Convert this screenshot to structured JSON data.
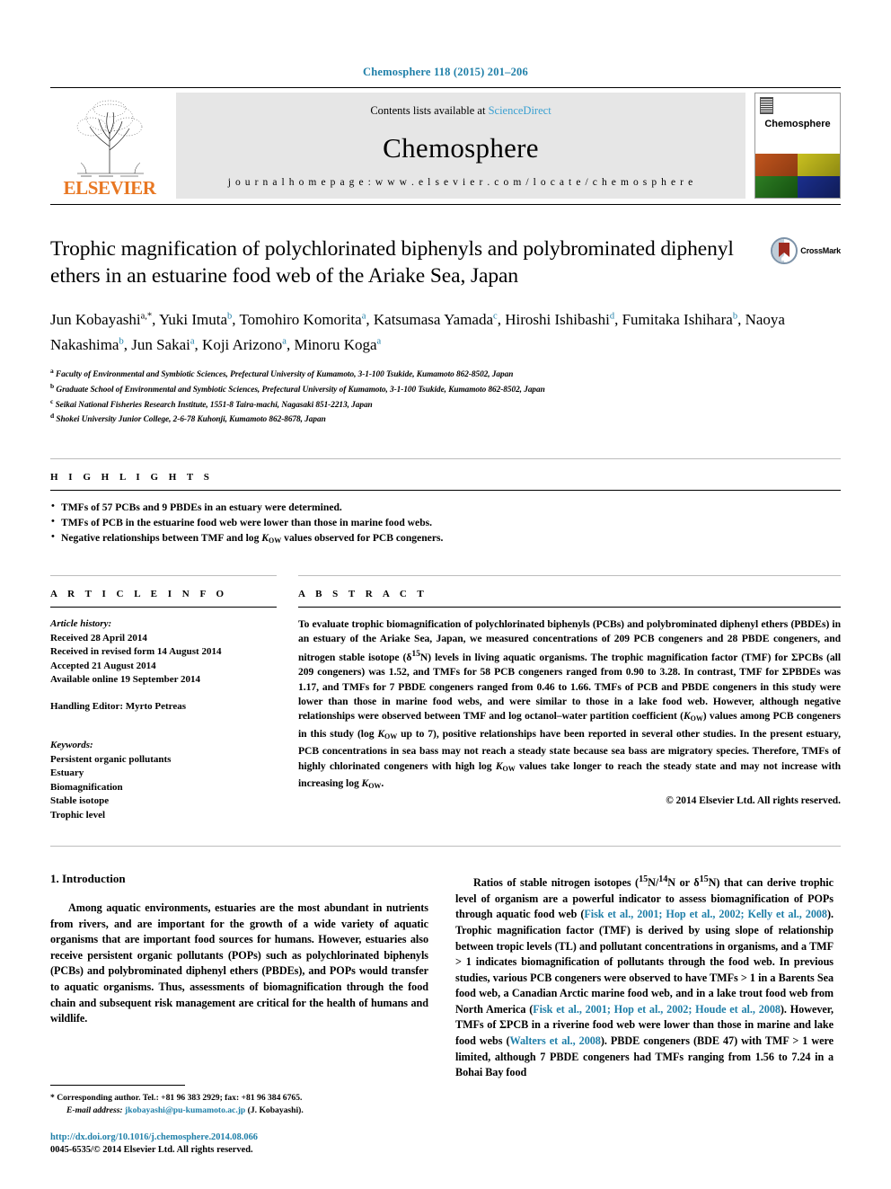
{
  "running_head": "Chemosphere 118 (2015) 201–206",
  "banner": {
    "publisher": "ELSEVIER",
    "contents_prefix": "Contents lists available at ",
    "contents_link": "ScienceDirect",
    "journal_name": "Chemosphere",
    "homepage": "j o u r n a l   h o m e p a g e :   w w w . e l s e v i e r . c o m / l o c a t e / c h e m o s p h e r e",
    "cover_title": "Chemosphere"
  },
  "article": {
    "title": "Trophic magnification of polychlorinated biphenyls and polybrominated diphenyl ethers in an estuarine food web of the Ariake Sea, Japan",
    "crossmark_label": "CrossMark",
    "authors_line_1": "Jun Kobayashi",
    "authors": [
      {
        "name": "Jun Kobayashi",
        "marks": "a,*"
      },
      {
        "name": "Yuki Imuta",
        "marks": "b"
      },
      {
        "name": "Tomohiro Komorita",
        "marks": "a"
      },
      {
        "name": "Katsumasa Yamada",
        "marks": "c"
      },
      {
        "name": "Hiroshi Ishibashi",
        "marks": "d"
      },
      {
        "name": "Fumitaka Ishihara",
        "marks": "b"
      },
      {
        "name": "Naoya Nakashima",
        "marks": "b"
      },
      {
        "name": "Jun Sakai",
        "marks": "a"
      },
      {
        "name": "Koji Arizono",
        "marks": "a"
      },
      {
        "name": "Minoru Koga",
        "marks": "a"
      }
    ],
    "affiliations": [
      {
        "mark": "a",
        "text": "Faculty of Environmental and Symbiotic Sciences, Prefectural University of Kumamoto, 3-1-100 Tsukide, Kumamoto 862-8502, Japan"
      },
      {
        "mark": "b",
        "text": "Graduate School of Environmental and Symbiotic Sciences, Prefectural University of Kumamoto, 3-1-100 Tsukide, Kumamoto 862-8502, Japan"
      },
      {
        "mark": "c",
        "text": "Seikai National Fisheries Research Institute, 1551-8 Taira-machi, Nagasaki 851-2213, Japan"
      },
      {
        "mark": "d",
        "text": "Shokei University Junior College, 2-6-78 Kuhonji, Kumamoto 862-8678, Japan"
      }
    ]
  },
  "highlights": {
    "heading": "H I G H L I G H T S",
    "items": [
      "TMFs of 57 PCBs and 9 PBDEs in an estuary were determined.",
      "TMFs of PCB in the estuarine food web were lower than those in marine food webs.",
      "Negative relationships between TMF and log KOW values observed for PCB congeners."
    ]
  },
  "article_info": {
    "heading": "A R T I C L E   I N F O",
    "history_label": "Article history:",
    "history": [
      "Received 28 April 2014",
      "Received in revised form 14 August 2014",
      "Accepted 21 August 2014",
      "Available online 19 September 2014"
    ],
    "handling_editor": "Handling Editor: Myrto Petreas",
    "keywords_label": "Keywords:",
    "keywords": [
      "Persistent organic pollutants",
      "Estuary",
      "Biomagnification",
      "Stable isotope",
      "Trophic level"
    ]
  },
  "abstract": {
    "heading": "A B S T R A C T",
    "text_part_1": "To evaluate trophic biomagnification of polychlorinated biphenyls (PCBs) and polybrominated diphenyl ethers (PBDEs) in an estuary of the Ariake Sea, Japan, we measured concentrations of 209 PCB congeners and 28 PBDE congeners, and nitrogen stable isotope (δ",
    "isotope_sup": "15",
    "text_part_2": "N) levels in living aquatic organisms. The trophic magnification factor (TMF) for ΣPCBs (all 209 congeners) was 1.52, and TMFs for 58 PCB congeners ranged from 0.90 to 3.28. In contrast, TMF for ΣPBDEs was 1.17, and TMFs for 7 PBDE congeners ranged from 0.46 to 1.66. TMFs of PCB and PBDE congeners in this study were lower than those in marine food webs, and were similar to those in a lake food web. However, although negative relationships were observed between TMF and log octanol–water partition coefficient (",
    "kow_1": "KOW",
    "text_part_3": ") values among PCB congeners in this study (log ",
    "kow_2": "KOW",
    "text_part_4": " up to 7), positive relationships have been reported in several other studies. In the present estuary, PCB concentrations in sea bass may not reach a steady state because sea bass are migratory species. Therefore, TMFs of highly chlorinated congeners with high log ",
    "kow_3": "KOW",
    "text_part_5": " values take longer to reach the steady state and may not increase with increasing log ",
    "kow_4": "KOW",
    "text_part_6": ".",
    "copyright": "© 2014 Elsevier Ltd. All rights reserved."
  },
  "introduction": {
    "heading": "1. Introduction",
    "left_paragraph": "Among aquatic environments, estuaries are the most abundant in nutrients from rivers, and are important for the growth of a wide variety of aquatic organisms that are important food sources for humans. However, estuaries also receive persistent organic pollutants (POPs) such as polychlorinated biphenyls (PCBs) and polybrominated diphenyl ethers (PBDEs), and POPs would transfer to aquatic organisms. Thus, assessments of biomagnification through the food chain and subsequent risk management are critical for the health of humans and wildlife.",
    "right_para_p1": "Ratios of stable nitrogen isotopes (",
    "right_sup_15a": "15",
    "right_p2": "N/",
    "right_sup_14": "14",
    "right_p3": "N or δ",
    "right_sup_15b": "15",
    "right_p4": "N) that can derive trophic level of organism are a powerful indicator to assess biomagnification of POPs through aquatic food web (",
    "right_ref1": "Fisk et al., 2001; Hop et al., 2002; Kelly et al., 2008",
    "right_p5": "). Trophic magnification factor (TMF) is derived by using slope of relationship between tropic levels (TL) and pollutant concentrations in organisms, and a TMF > 1 indicates biomagnification of pollutants through the food web. In previous studies, various PCB congeners were observed to have TMFs > 1 in a Barents Sea food web, a Canadian Arctic marine food web, and in a lake trout food web from North America (",
    "right_ref2": "Fisk et al., 2001; Hop et al., 2002; Houde et al., 2008",
    "right_p6": "). However, TMFs of ΣPCB in a riverine food web were lower than those in marine and lake food webs (",
    "right_ref3": "Walters et al., 2008",
    "right_p7": "). PBDE congeners (BDE 47) with TMF > 1 were limited, although 7 PBDE congeners had TMFs ranging from 1.56 to 7.24 in a Bohai Bay food"
  },
  "footnote": {
    "corresponding_marker": "*",
    "corresponding_text": "Corresponding author. Tel.: +81 96 383 2929; fax: +81 96 384 6765.",
    "email_label": "E-mail address:",
    "email": "jkobayashi@pu-kumamoto.ac.jp",
    "email_suffix": "(J. Kobayashi).",
    "doi": "http://dx.doi.org/10.1016/j.chemosphere.2014.08.066",
    "issn": "0045-6535/© 2014 Elsevier Ltd. All rights reserved."
  },
  "colors": {
    "link": "#1f7fa8",
    "elsevier_orange": "#E87722",
    "banner_gray": "#e6e6e6"
  }
}
